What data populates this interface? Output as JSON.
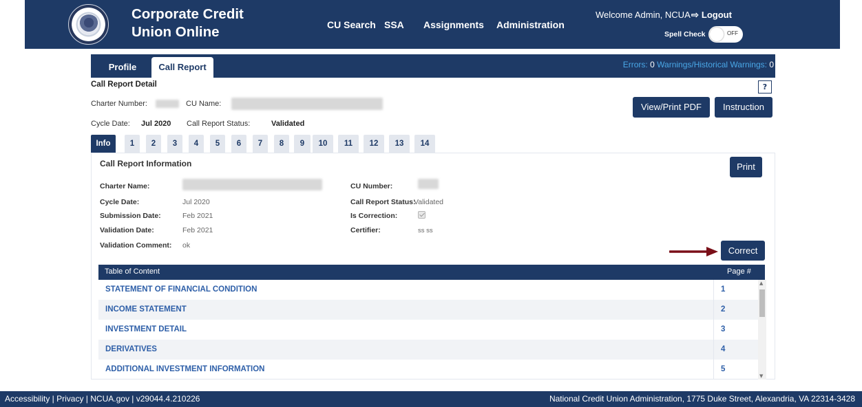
{
  "header": {
    "brand_line1": "Corporate Credit",
    "brand_line2": "Union Online",
    "nav": [
      "CU Search",
      "SSA",
      "Assignments",
      "Administration"
    ],
    "welcome": "Welcome Admin, NCUA",
    "logout": "Logout",
    "spell_check_label": "Spell Check",
    "spell_check_state": "OFF"
  },
  "subnav": {
    "tabs": [
      "Profile",
      "Call Report"
    ],
    "active_tab": "Call Report",
    "errors_label": "Errors:",
    "errors_count": "0",
    "warnings_label": "Warnings/Historical Warnings:",
    "warnings_count": "0"
  },
  "call_report": {
    "title": "Call Report Detail",
    "help": "?",
    "charter_number_label": "Charter Number:",
    "cu_name_label": "CU Name:",
    "cycle_date_label": "Cycle Date:",
    "cycle_date_value": "Jul 2020",
    "status_label": "Call Report Status:",
    "status_value": "Validated",
    "view_pdf_button": "View/Print PDF",
    "instruction_button": "Instruction"
  },
  "section_tabs": [
    "Info",
    "1",
    "2",
    "3",
    "4",
    "5",
    "6",
    "7",
    "8",
    "9",
    "10",
    "11",
    "12",
    "13",
    "14"
  ],
  "info_panel": {
    "title": "Call Report Information",
    "print_button": "Print",
    "correct_button": "Correct",
    "fields": {
      "charter_name_label": "Charter Name:",
      "cu_number_label": "CU Number:",
      "cycle_date_label": "Cycle Date:",
      "cycle_date_value": "Jul 2020",
      "status_label": "Call Report Status:",
      "status_value": "Validated",
      "submission_date_label": "Submission Date:",
      "submission_date_value": "Feb 2021",
      "is_correction_label": "Is Correction:",
      "validation_date_label": "Validation Date:",
      "validation_date_value": "Feb 2021",
      "certifier_label": "Certifier:",
      "certifier_value": "ss ss",
      "validation_comment_label": "Validation Comment:",
      "validation_comment_value": "ok"
    }
  },
  "toc": {
    "header_name": "Table of Content",
    "header_page": "Page #",
    "rows": [
      {
        "name": "STATEMENT OF FINANCIAL CONDITION",
        "page": "1"
      },
      {
        "name": "INCOME STATEMENT",
        "page": "2"
      },
      {
        "name": "INVESTMENT DETAIL",
        "page": "3"
      },
      {
        "name": "DERIVATIVES",
        "page": "4"
      },
      {
        "name": "ADDITIONAL INVESTMENT INFORMATION",
        "page": "5"
      }
    ]
  },
  "footer": {
    "left": "Accessibility | Privacy | NCUA.gov | v29044.4.210226",
    "right": "National Credit Union Administration, 1775 Duke Street, Alexandria, VA 22314-3428"
  },
  "colors": {
    "navy": "#1e3a66",
    "link_blue": "#2e5fa8",
    "accent_arrow": "#7a0f18"
  }
}
